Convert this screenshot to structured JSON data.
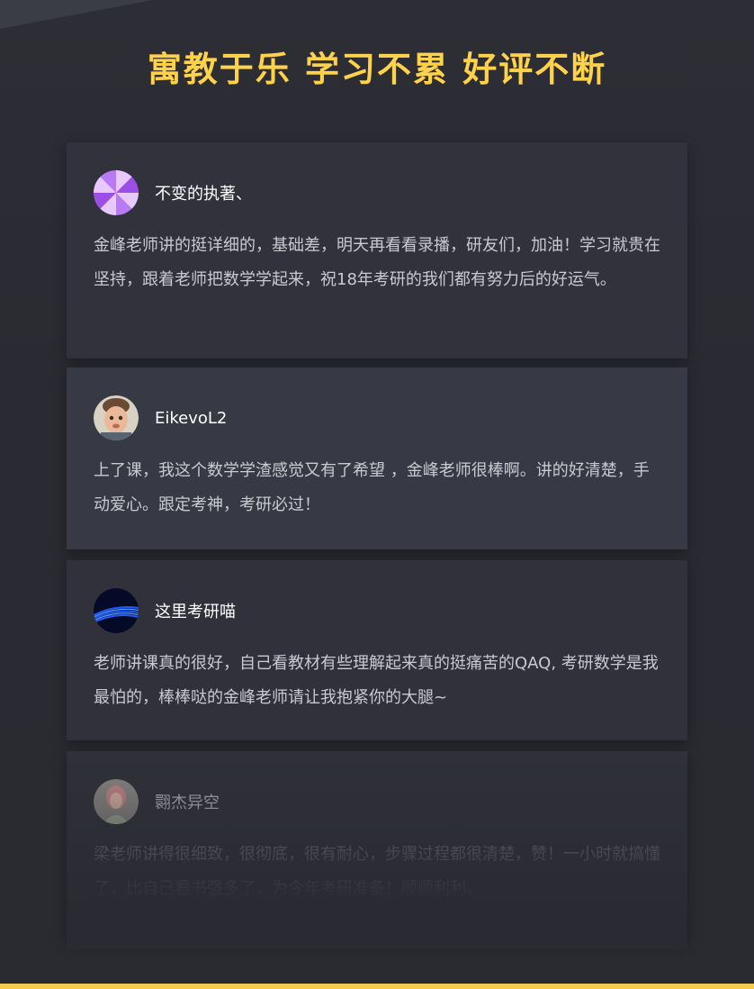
{
  "headline": "寓教于乐 学习不累 好评不断",
  "reviews": [
    {
      "username": "不变的执著、",
      "avatar_icon": "purple-pinwheel-avatar",
      "comment": "金峰老师讲的挺详细的，基础差，明天再看看录播，研友们，加油！学习就贵在坚持，跟着老师把数学学起来，祝18年考研的我们都有努力后的好运气。"
    },
    {
      "username": "EikevoL2",
      "avatar_icon": "child-photo-avatar",
      "comment": "上了课，我这个数学学渣感觉又有了希望 ，金峰老师很棒啊。讲的好清楚，手动爱心。跟定考神，考研必过！"
    },
    {
      "username": "这里考研喵",
      "avatar_icon": "blue-lines-avatar",
      "comment": "老师讲课真的很好，自己看教材有些理解起来真的挺痛苦的QAQ, 考研数学是我最怕的，棒棒哒的金峰老师请让我抱紧你的大腿~"
    },
    {
      "username": "翾杰异空",
      "avatar_icon": "girl-photo-avatar",
      "comment": "梁老师讲得很细致，很彻底，很有耐心，步骤过程都很清楚，赞！一小时就搞懂了，比自己看书强多了，为今年考研准备！顺顺利利。"
    }
  ],
  "colors": {
    "background": "#2a2b32",
    "headline": "#ffd24a",
    "accent_bar": "#f2c94c"
  }
}
